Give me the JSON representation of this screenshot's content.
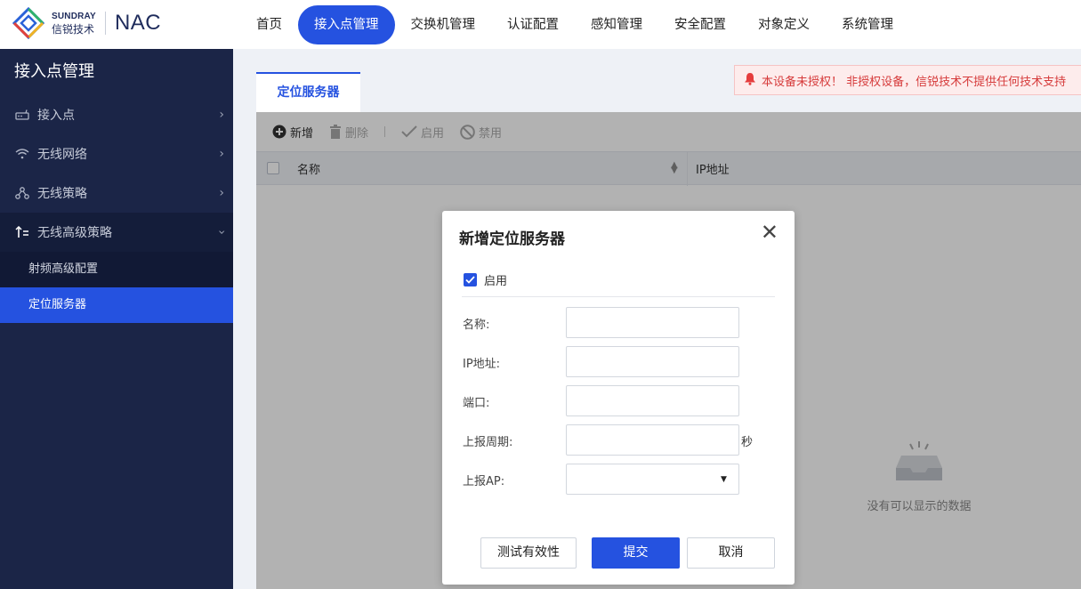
{
  "header": {
    "brand_en": "SUNDRAY",
    "brand_cn": "信锐技术",
    "product": "NAC",
    "nav": [
      {
        "label": "首页",
        "active": false
      },
      {
        "label": "接入点管理",
        "active": true
      },
      {
        "label": "交换机管理",
        "active": false
      },
      {
        "label": "认证配置",
        "active": false
      },
      {
        "label": "感知管理",
        "active": false
      },
      {
        "label": "安全配置",
        "active": false
      },
      {
        "label": "对象定义",
        "active": false
      },
      {
        "label": "系统管理",
        "active": false
      }
    ]
  },
  "sidebar": {
    "title": "接入点管理",
    "items": [
      {
        "label": "接入点",
        "icon": "router-icon"
      },
      {
        "label": "无线网络",
        "icon": "wifi-icon"
      },
      {
        "label": "无线策略",
        "icon": "policy-icon"
      },
      {
        "label": "无线高级策略",
        "icon": "advanced-policy-icon",
        "open": true
      }
    ],
    "subitems": [
      {
        "label": "射频高级配置",
        "active": false
      },
      {
        "label": "定位服务器",
        "active": true
      }
    ]
  },
  "main": {
    "tab": "定位服务器",
    "warning": "本设备未授权！ 非授权设备，信锐技术不提供任何技术支持",
    "toolbar": {
      "add": "新增",
      "delete": "删除",
      "enable": "启用",
      "disable": "禁用"
    },
    "table": {
      "columns": [
        "名称",
        "IP地址"
      ]
    },
    "empty_text": "没有可以显示的数据"
  },
  "dialog": {
    "title": "新增定位服务器",
    "enable_label": "启用",
    "enabled": true,
    "fields": {
      "name_label": "名称:",
      "ip_label": "IP地址:",
      "port_label": "端口:",
      "period_label": "上报周期:",
      "period_unit": "秒",
      "ap_label": "上报AP:"
    },
    "buttons": {
      "test": "测试有效性",
      "submit": "提交",
      "cancel": "取消"
    }
  },
  "colors": {
    "accent": "#2552e0",
    "sidebar_bg": "#1b2547",
    "warning_text": "#d63b3b"
  }
}
